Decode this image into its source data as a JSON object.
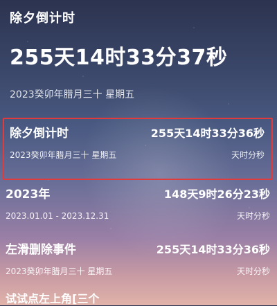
{
  "header": {
    "title": "除夕倒计时",
    "countdown": "255天14时33分37秒",
    "date": "2023癸卯年腊月三十 星期五"
  },
  "events": [
    {
      "name": "除夕倒计时",
      "countdown": "255天14时33分36秒",
      "date": "2023癸卯年腊月三十 星期五",
      "unit": "天时分秒",
      "highlighted": true
    },
    {
      "name": "2023年",
      "countdown": "148天9时26分23秒",
      "date": "2023.01.01 - 2023.12.31",
      "unit": "天时分秒",
      "highlighted": false
    },
    {
      "name": "左滑删除事件",
      "countdown": "255天14时33分36秒",
      "date": "2023癸卯年腊月三十 星期五",
      "unit": "天时分秒",
      "highlighted": false
    }
  ],
  "partial_item": {
    "name": "试试点左上角[三个"
  },
  "colors": {
    "highlight_border": "#e23b3b",
    "text": "#ffffff"
  }
}
